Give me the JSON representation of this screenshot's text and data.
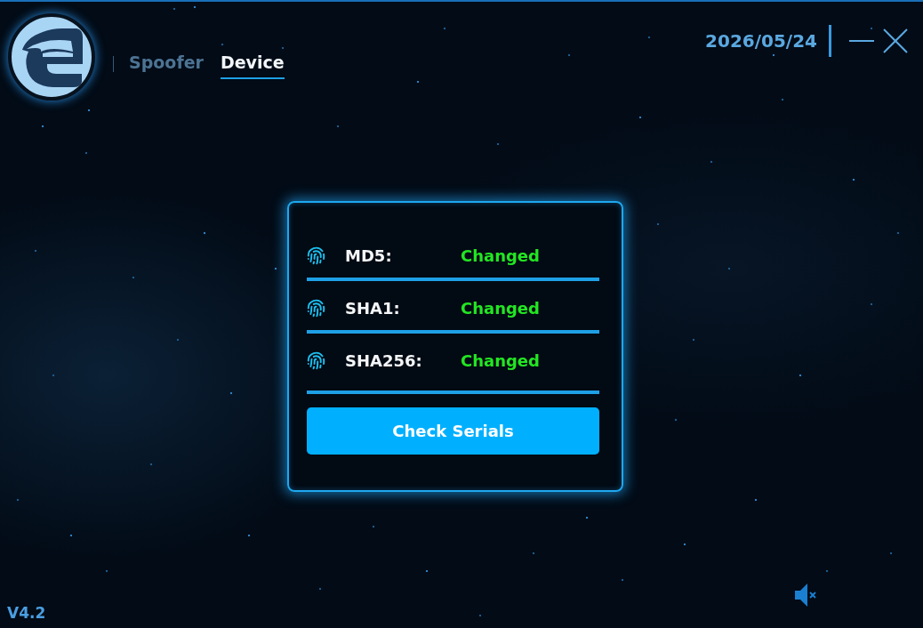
{
  "nav": {
    "tabs": [
      {
        "label": "Spoofer",
        "selected": false
      },
      {
        "label": "Device",
        "selected": true
      }
    ]
  },
  "date": "2026/05/24",
  "hashes": [
    {
      "label": "MD5:",
      "status": "Changed"
    },
    {
      "label": "SHA1:",
      "status": "Changed"
    },
    {
      "label": "SHA256:",
      "status": "Changed"
    }
  ],
  "check_button": "Check Serials",
  "version": "V4.2",
  "sound": {
    "muted": true
  }
}
